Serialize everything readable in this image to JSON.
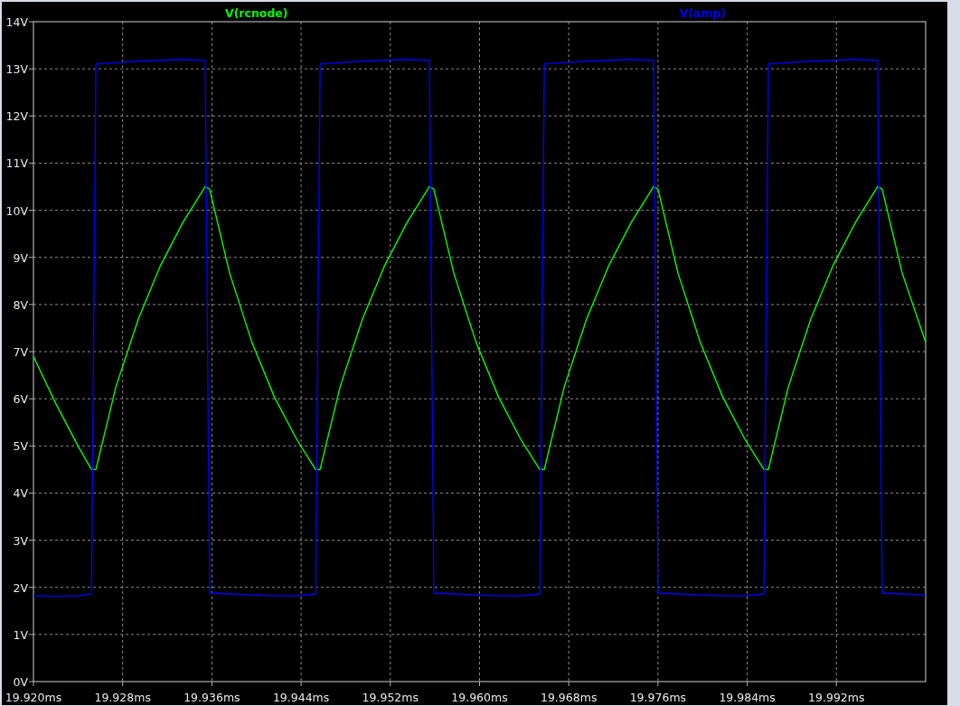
{
  "chart_data": {
    "type": "line",
    "grid": true,
    "xlim": [
      19.92,
      20.0
    ],
    "ylim": [
      0,
      14
    ],
    "xticks": [
      {
        "value": 19.92,
        "label": "19.920ms"
      },
      {
        "value": 19.928,
        "label": "19.928ms"
      },
      {
        "value": 19.936,
        "label": "19.936ms"
      },
      {
        "value": 19.944,
        "label": "19.944ms"
      },
      {
        "value": 19.952,
        "label": "19.952ms"
      },
      {
        "value": 19.96,
        "label": "19.960ms"
      },
      {
        "value": 19.968,
        "label": "19.968ms"
      },
      {
        "value": 19.976,
        "label": "19.976ms"
      },
      {
        "value": 19.984,
        "label": "19.984ms"
      },
      {
        "value": 19.992,
        "label": "19.992ms"
      }
    ],
    "yticks": [
      {
        "value": 0,
        "label": "0V"
      },
      {
        "value": 1,
        "label": "1V"
      },
      {
        "value": 2,
        "label": "2V"
      },
      {
        "value": 3,
        "label": "3V"
      },
      {
        "value": 4,
        "label": "4V"
      },
      {
        "value": 5,
        "label": "5V"
      },
      {
        "value": 6,
        "label": "6V"
      },
      {
        "value": 7,
        "label": "7V"
      },
      {
        "value": 8,
        "label": "8V"
      },
      {
        "value": 9,
        "label": "9V"
      },
      {
        "value": 10,
        "label": "10V"
      },
      {
        "value": 11,
        "label": "11V"
      },
      {
        "value": 12,
        "label": "12V"
      },
      {
        "value": 13,
        "label": "13V"
      },
      {
        "value": 14,
        "label": "14V"
      }
    ],
    "x": [
      19.92,
      19.922,
      19.924,
      19.9252,
      19.9256,
      19.9274,
      19.9294,
      19.9314,
      19.9334,
      19.9354,
      19.9358,
      19.9376,
      19.9396,
      19.9416,
      19.9436,
      19.9453,
      19.9457,
      19.9475,
      19.9495,
      19.9515,
      19.9535,
      19.9555,
      19.9559,
      19.9577,
      19.9597,
      19.9617,
      19.9637,
      19.9654,
      19.9658,
      19.9676,
      19.9696,
      19.9716,
      19.9736,
      19.9756,
      19.976,
      19.9778,
      19.9798,
      19.9818,
      19.9838,
      19.9855,
      19.9859,
      19.9877,
      19.9897,
      19.9917,
      19.9937,
      19.9957,
      19.9961,
      19.9979,
      20.0
    ],
    "series": [
      {
        "name": "V(rcnode)",
        "color": "#00ff00",
        "values": [
          6.9,
          5.9,
          5.0,
          4.5,
          4.5,
          6.26,
          7.69,
          8.83,
          9.74,
          10.5,
          10.45,
          8.66,
          7.19,
          6.04,
          5.14,
          4.5,
          4.5,
          6.26,
          7.69,
          8.83,
          9.74,
          10.5,
          10.45,
          8.66,
          7.19,
          6.04,
          5.14,
          4.5,
          4.5,
          6.26,
          7.69,
          8.83,
          9.74,
          10.5,
          10.45,
          8.66,
          7.19,
          6.04,
          5.14,
          4.5,
          4.5,
          6.26,
          7.69,
          8.83,
          9.74,
          10.5,
          10.45,
          8.66,
          7.2
        ]
      },
      {
        "name": "V(amp)",
        "color": "#0000ff",
        "values": [
          1.82,
          1.81,
          1.82,
          1.86,
          13.1,
          13.13,
          13.16,
          13.18,
          13.2,
          13.18,
          1.88,
          1.86,
          1.84,
          1.82,
          1.82,
          1.86,
          13.1,
          13.13,
          13.16,
          13.18,
          13.2,
          13.18,
          1.88,
          1.86,
          1.84,
          1.82,
          1.82,
          1.86,
          13.1,
          13.13,
          13.16,
          13.18,
          13.2,
          13.18,
          1.88,
          1.86,
          1.84,
          1.82,
          1.82,
          1.86,
          13.1,
          13.13,
          13.16,
          13.18,
          13.2,
          13.18,
          1.88,
          1.86,
          1.84
        ]
      }
    ]
  }
}
